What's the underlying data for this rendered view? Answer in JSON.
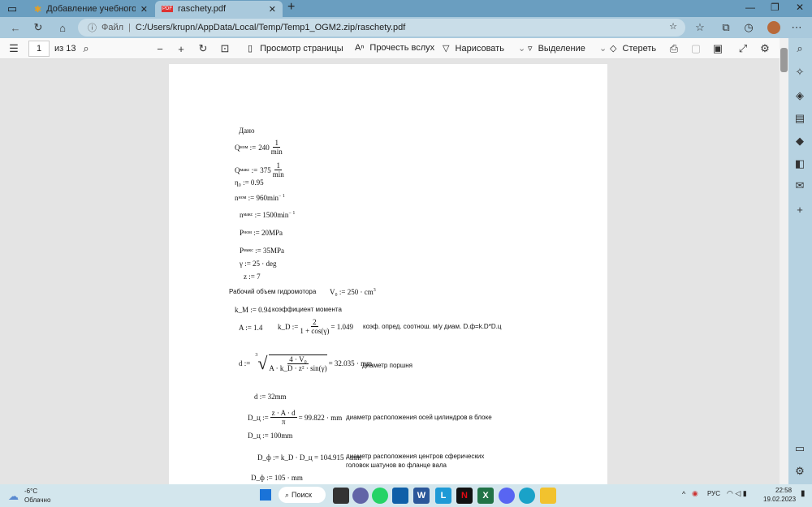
{
  "browser": {
    "tabs": [
      {
        "title": "Добавление учебного материа",
        "icon": "moodle-icon"
      },
      {
        "title": "raschety.pdf",
        "icon": "pdf-icon"
      }
    ],
    "new_tab": "+",
    "address_label": "Файл",
    "url": "C:/Users/krupn/AppData/Local/Temp/Temp1_OGM2.zip/raschety.pdf"
  },
  "pdf_toolbar": {
    "page": "1",
    "page_of": "из 13",
    "page_view": "Просмотр страницы",
    "read_aloud": "Прочесть вслух",
    "draw": "Нарисовать",
    "highlight": "Выделение",
    "erase": "Стереть"
  },
  "doc": {
    "heading": "Дано",
    "q_nom": {
      "sym": "Q",
      "sub": "ном",
      "val": "240",
      "num": "1",
      "den": "min"
    },
    "q_max": {
      "sym": "Q",
      "sub": "макс",
      "val": "375",
      "num": "1",
      "den": "min"
    },
    "eta": "η₀ := 0.95",
    "n_nom": {
      "sym": "n",
      "sub": "ном",
      "val": ":= 960min",
      "exp": "− 1"
    },
    "n_max": {
      "sym": "n",
      "sub": "макс",
      "val": ":= 1500min",
      "exp": "− 1"
    },
    "p_nom": {
      "sym": "P",
      "sub": "ном",
      "val": ":= 20MPa"
    },
    "p_max": {
      "sym": "P",
      "sub": "макс",
      "val": ":= 35MPa"
    },
    "gamma": "γ := 25 · deg",
    "z": "z := 7",
    "v0_label": "Рабочий объем гидромотора",
    "v0": "V₀ := 250 · cm",
    "v0_exp": "3",
    "km": "k_M := 0.94",
    "km_label": "коэффициент момента",
    "A": "A := 1.4",
    "kd_lhs": "k_D :=",
    "kd_num": "2",
    "kd_den": "1 + cos(γ)",
    "kd_res": "= 1.049",
    "kd_label": "коэф. опред. соотнош. м/у диам. D.ф=k.D*D.ц",
    "d_lhs": "d :=",
    "d_root": "3",
    "d_num": "4 · V₀",
    "d_den": "A · k_D · z² · sin(γ)",
    "d_res": "= 32.035 · mm",
    "d_label": "диаметр поршня",
    "d2": "d := 32mm",
    "dc_lhs": "D_ц :=",
    "dc_num": "z · A · d",
    "dc_den": "π",
    "dc_res": "= 99.822 · mm",
    "dc_label": "диаметр расположения осей цилиндров в блоке",
    "dc2": "D_ц := 100mm",
    "df": "D_ф := k_D · D_ц = 104.915 · mm",
    "df_label1": "диаметр расположения центров сферических",
    "df_label2": "головок шатунов во фланце вала",
    "df2": "D_ф := 105 · mm"
  },
  "taskbar": {
    "temp": "-6°C",
    "weather": "Облачно",
    "search": "Поиск",
    "lang": "РУС",
    "time": "22:58",
    "date": "19.02.2023"
  }
}
